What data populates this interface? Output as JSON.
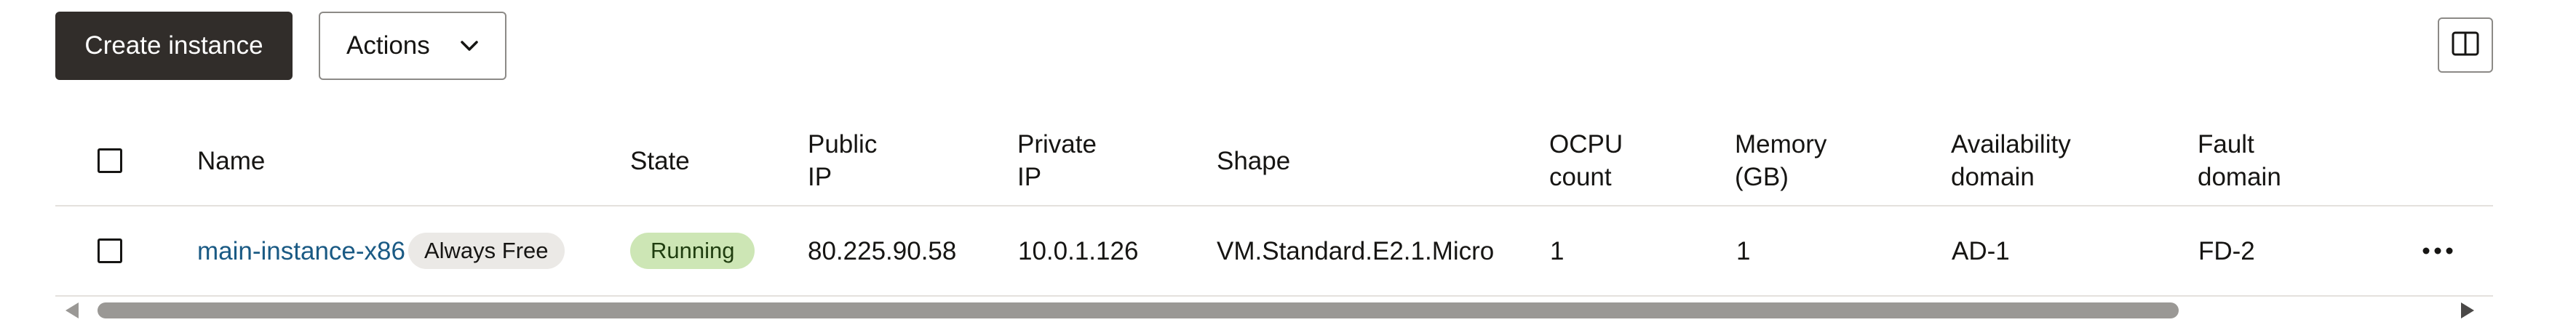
{
  "toolbar": {
    "create_label": "Create instance",
    "actions_label": "Actions"
  },
  "table": {
    "headers": {
      "name": "Name",
      "state": "State",
      "public_ip": "Public\nIP",
      "private_ip": "Private\nIP",
      "shape": "Shape",
      "ocpu_count": "OCPU\ncount",
      "memory": "Memory\n(GB)",
      "availability_domain": "Availability\ndomain",
      "fault_domain": "Fault\ndomain"
    },
    "rows": [
      {
        "name": "main-instance-x86",
        "tag": "Always Free",
        "state": "Running",
        "public_ip": "80.225.90.58",
        "private_ip": "10.0.1.126",
        "shape": "VM.Standard.E2.1.Micro",
        "ocpu_count": "1",
        "memory": "1",
        "availability_domain": "AD-1",
        "fault_domain": "FD-2"
      }
    ]
  },
  "icons": {
    "actions_dropdown": "chevron-down-icon",
    "column_toggle": "columns-icon",
    "row_menu": "more-horizontal-icon"
  },
  "colors": {
    "primary_button": "#312d2a",
    "link": "#1a5a84",
    "status_running_bg": "#cde6b5",
    "tag_bg": "#ebe9e6"
  }
}
